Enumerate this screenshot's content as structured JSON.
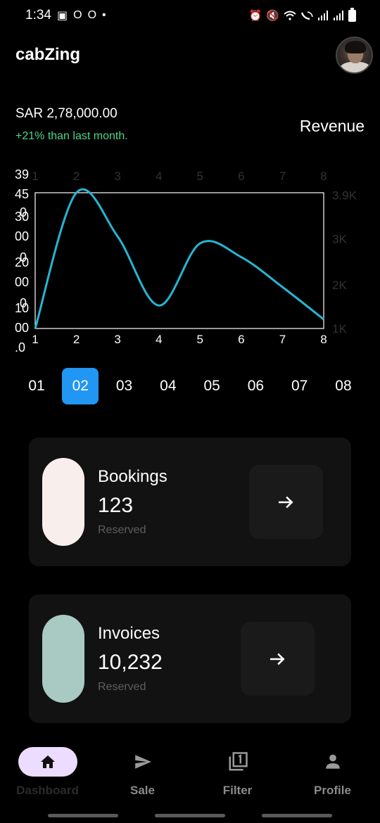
{
  "status_bar": {
    "time": "1:34",
    "indicators": [
      "image-icon",
      "ring-icon",
      "ring-icon",
      "dot-icon"
    ],
    "right_icons": [
      "alarm-icon",
      "mute-icon",
      "wifi-icon",
      "wifi-call-icon",
      "signal-icon",
      "signal-icon",
      "battery-icon"
    ]
  },
  "app": {
    "title": "cabZing"
  },
  "summary": {
    "amount": "SAR 2,78,000.00",
    "change": "+21% than last month.",
    "label": "Revenue"
  },
  "chart_data": {
    "type": "line",
    "x": [
      1,
      2,
      3,
      4,
      5,
      6,
      7,
      8
    ],
    "top_axis_labels": [
      "1",
      "2",
      "3",
      "4",
      "5",
      "6",
      "7",
      "8"
    ],
    "bottom_axis_labels": [
      "1",
      "2",
      "3",
      "4",
      "5",
      "6",
      "7",
      "8"
    ],
    "left_axis_labels": [
      "39",
      "45",
      "30",
      "00",
      "20",
      "00",
      "10",
      "00",
      ".0"
    ],
    "left_axis_overlap_labels": [
      "0",
      "0",
      "0"
    ],
    "right_axis_labels": [
      "3.9K",
      "3K",
      "2K",
      "1K"
    ],
    "ylim": [
      1000,
      3950
    ],
    "series": [
      {
        "values": [
          1000,
          3950,
          3000,
          1500,
          2850,
          2550,
          1900,
          1200
        ]
      }
    ],
    "line_color": "#26b5d4",
    "grid": false
  },
  "months": {
    "items": [
      "01",
      "02",
      "03",
      "04",
      "05",
      "06",
      "07",
      "08"
    ],
    "active_index": 1,
    "active_color": "#2196f3"
  },
  "cards": [
    {
      "title": "Bookings",
      "value": "123",
      "subtitle": "Reserved",
      "pill_color": "#f8efec",
      "icon": "arrow-right-icon"
    },
    {
      "title": "Invoices",
      "value": "10,232",
      "subtitle": "Reserved",
      "pill_color": "#a9c9c3",
      "icon": "arrow-right-icon"
    }
  ],
  "bottom_nav": {
    "items": [
      {
        "label": "Dashboard",
        "icon": "home-icon",
        "active": true
      },
      {
        "label": "Sale",
        "icon": "send-icon",
        "active": false
      },
      {
        "label": "Filter",
        "icon": "filter-1-icon",
        "active": false
      },
      {
        "label": "Profile",
        "icon": "person-icon",
        "active": false
      }
    ],
    "active_pill_color": "#ecdcff"
  }
}
